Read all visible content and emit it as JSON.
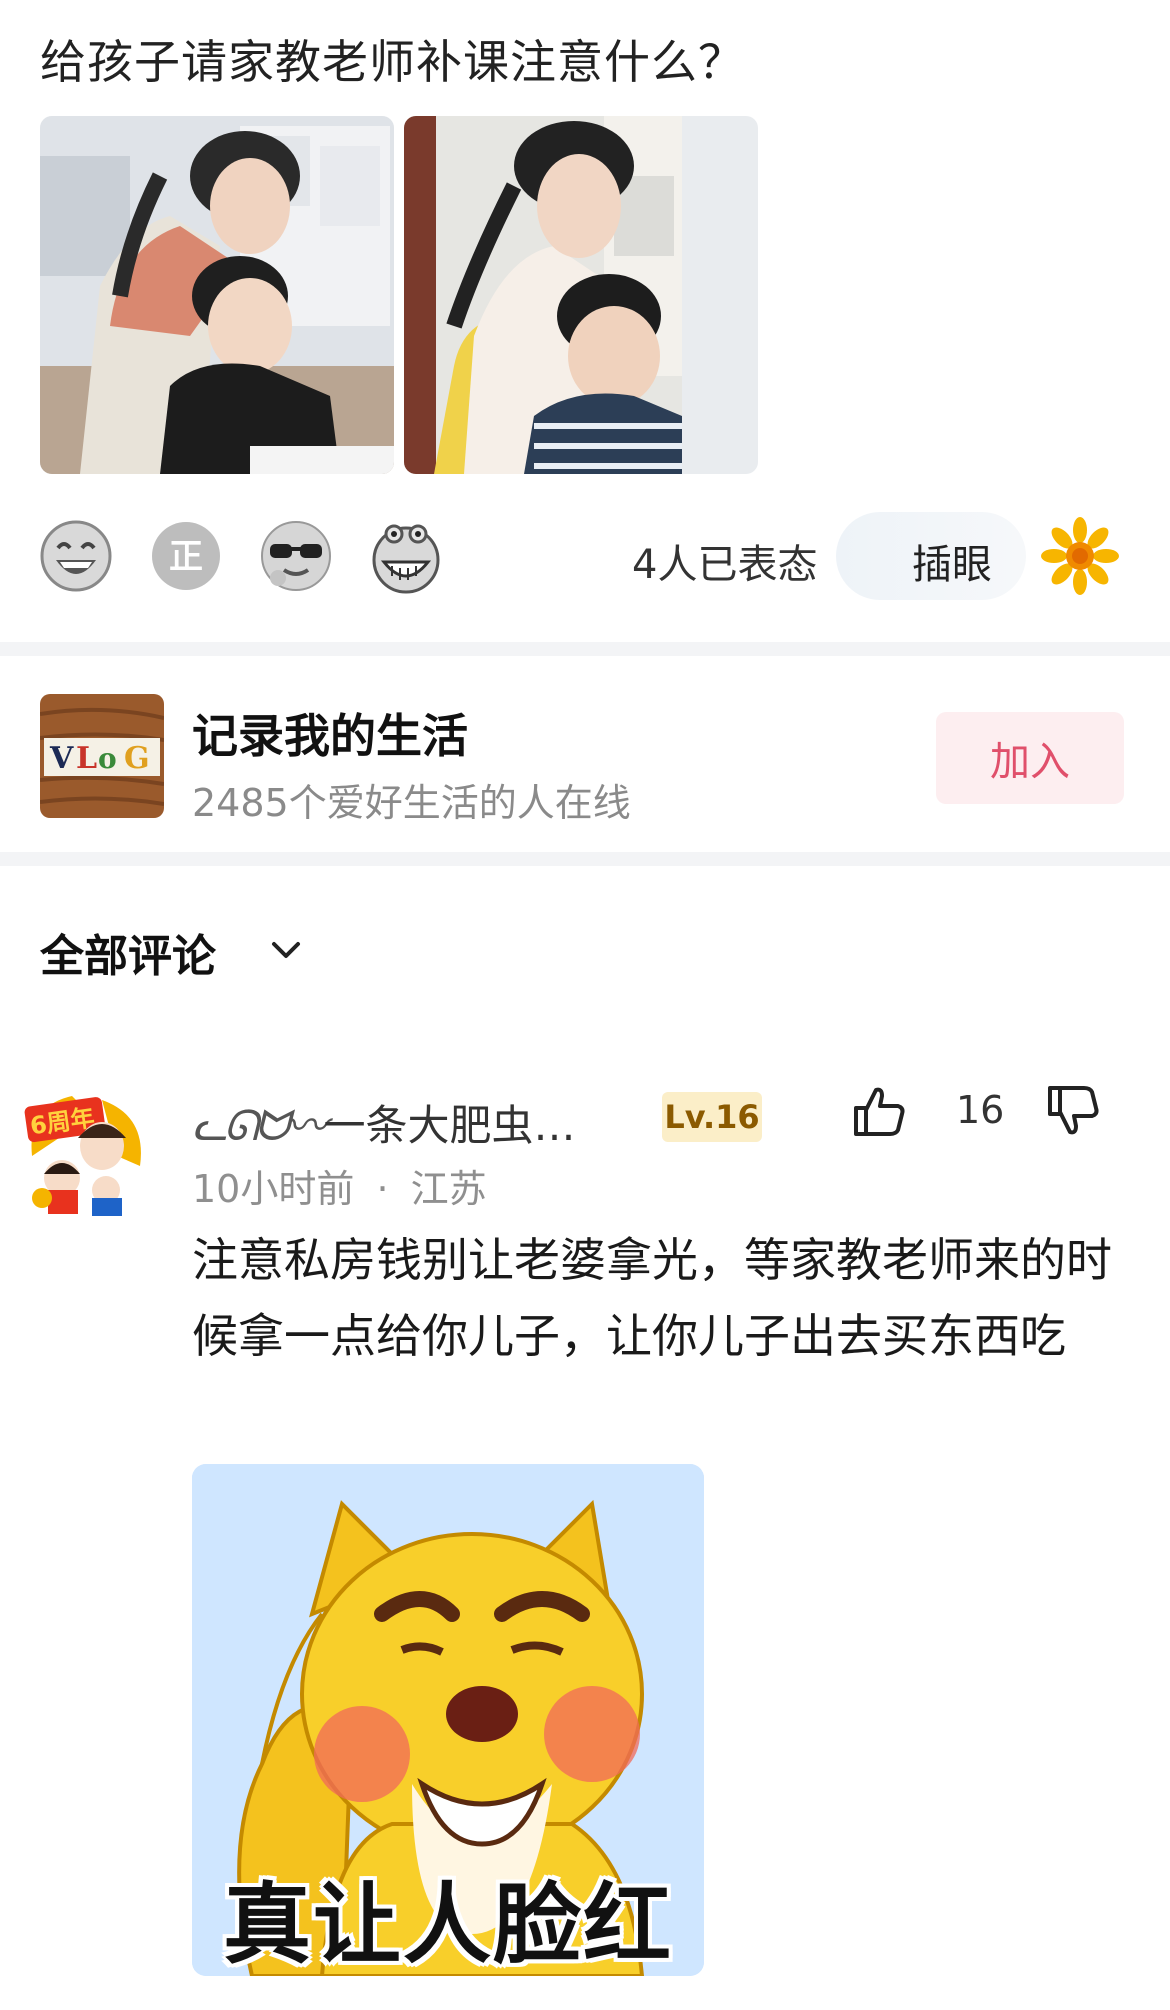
{
  "post": {
    "title": "给孩子请家教老师补课注意什么？"
  },
  "reactions": {
    "emojis": [
      "laughing-face-icon",
      "zheng-badge-icon",
      "sunglasses-face-icon",
      "grinning-ghost-icon"
    ],
    "count_text": "4人已表态",
    "action_label": "插眼",
    "action_icon": "sunflower-icon"
  },
  "group": {
    "logo_text": "VLoG",
    "name": "记录我的生活",
    "online_text": "2485个爱好生活的人在线",
    "join_label": "加入"
  },
  "comments": {
    "header": "全部评论"
  },
  "comment": {
    "username_deco": "ᓚᘏᗢ〰",
    "username": "一条大肥虫…",
    "level": "Lv.16",
    "like_count": "16",
    "time": "10小时前",
    "separator": "·",
    "location": "江苏",
    "text": "注意私房钱别让老婆拿光，等家教老师来的时候拿一点给你儿子，让你儿子出去买东西吃",
    "avatar_badge": "6周年",
    "sticker_caption": "真让人脸红"
  },
  "colors": {
    "accent_pink": "#e0506b",
    "level_badge_bg": "#fbeec8",
    "divider": "#f3f4f6"
  }
}
